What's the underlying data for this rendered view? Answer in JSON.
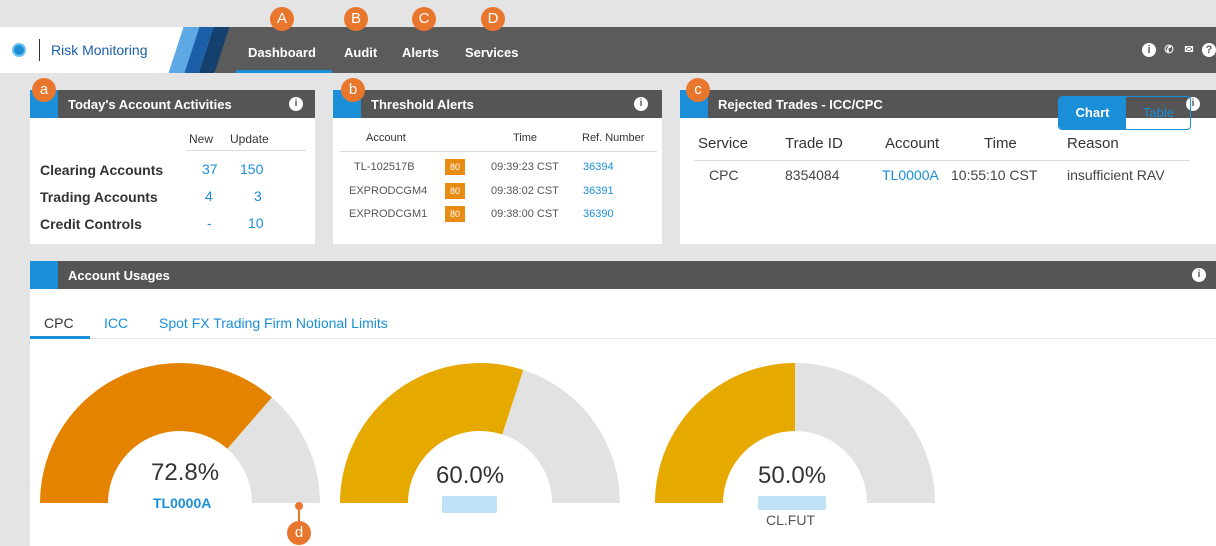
{
  "app": {
    "name": "Risk Monitoring"
  },
  "nav": {
    "items": [
      {
        "label": "Dashboard",
        "marker": "A"
      },
      {
        "label": "Audit",
        "marker": "B"
      },
      {
        "label": "Alerts",
        "marker": "C"
      },
      {
        "label": "Services",
        "marker": "D"
      }
    ]
  },
  "top_icons": [
    "info-icon",
    "phone-icon",
    "mail-icon",
    "help-icon"
  ],
  "colors": {
    "accent": "#1a8fd8",
    "header": "#555555",
    "orange": "#e8762d",
    "gauge_orange": "#e48300",
    "gauge_gold": "#e6a900",
    "gauge_track": "#e2e2e2"
  },
  "activities": {
    "marker": "a",
    "title": "Today's Account Activities",
    "col_new": "New",
    "col_update": "Update",
    "rows": [
      {
        "label": "Clearing Accounts",
        "new": "37",
        "update": "150"
      },
      {
        "label": "Trading Accounts",
        "new": "4",
        "update": "3"
      },
      {
        "label": "Credit Controls",
        "new": "-",
        "update": "10"
      }
    ]
  },
  "threshold": {
    "marker": "b",
    "title": "Threshold Alerts",
    "col_account": "Account",
    "col_time": "Time",
    "col_ref": "Ref. Number",
    "rows": [
      {
        "account": "TL-102517B",
        "level": "80",
        "time": "09:39:23 CST",
        "ref": "36394"
      },
      {
        "account": "EXPRODCGM4",
        "level": "80",
        "time": "09:38:02 CST",
        "ref": "36391"
      },
      {
        "account": "EXPRODCGM1",
        "level": "80",
        "time": "09:38:00 CST",
        "ref": "36390"
      }
    ]
  },
  "rejected": {
    "marker": "c",
    "title": "Rejected Trades - ICC/CPC",
    "headers": {
      "service": "Service",
      "trade_id": "Trade ID",
      "account": "Account",
      "time": "Time",
      "reason": "Reason"
    },
    "row": {
      "service": "CPC",
      "trade_id": "8354084",
      "account": "TL0000A",
      "time": "10:55:10 CST",
      "reason": "insufficient RAV"
    }
  },
  "usages": {
    "title": "Account Usages",
    "tabs": [
      {
        "label": "CPC"
      },
      {
        "label": "ICC"
      },
      {
        "label": "Spot FX Trading Firm Notional Limits"
      }
    ],
    "toggle": {
      "chart": "Chart",
      "table": "Table"
    },
    "gauges": [
      {
        "percent": "72.8%",
        "fraction": 0.728,
        "label": "TL0000A",
        "marker": "d"
      },
      {
        "percent": "60.0%",
        "fraction": 0.6,
        "label": ""
      },
      {
        "percent": "50.0%",
        "fraction": 0.5,
        "label": "CL.FUT"
      }
    ]
  }
}
